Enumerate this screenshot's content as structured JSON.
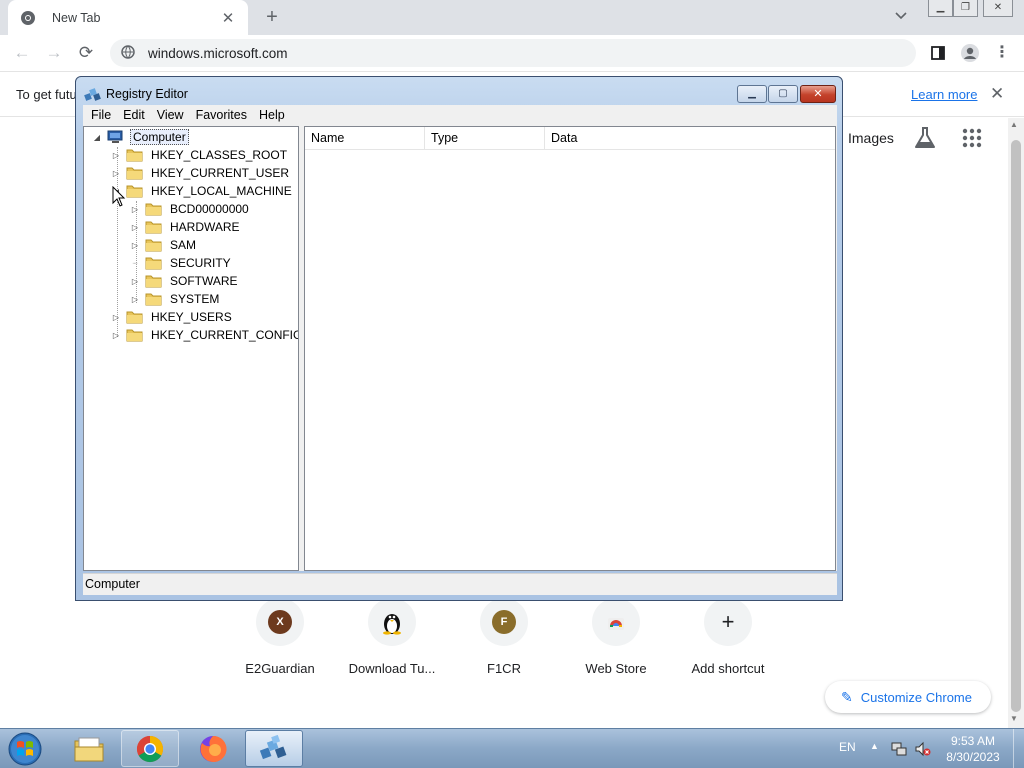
{
  "browser": {
    "tab_title": "New Tab",
    "url": "windows.microsoft.com",
    "infobar_text": "To get futu",
    "infobar_link": "Learn more"
  },
  "ntp": {
    "images_link": "Images",
    "shortcuts": [
      {
        "label": "E2Guardian",
        "letter": "X",
        "color": "#6d3a1e"
      },
      {
        "label": "Download Tu...",
        "letter": "",
        "color": ""
      },
      {
        "label": "F1CR",
        "letter": "F",
        "color": "#8a6d2b"
      },
      {
        "label": "Web Store",
        "letter": "",
        "color": ""
      },
      {
        "label": "Add shortcut",
        "letter": "+",
        "color": ""
      }
    ],
    "customize_label": "Customize Chrome"
  },
  "regedit": {
    "title": "Registry Editor",
    "menu": [
      "File",
      "Edit",
      "View",
      "Favorites",
      "Help"
    ],
    "tree": {
      "root": "Computer",
      "hives": [
        "HKEY_CLASSES_ROOT",
        "HKEY_CURRENT_USER",
        "HKEY_LOCAL_MACHINE",
        "HKEY_USERS",
        "HKEY_CURRENT_CONFIG"
      ],
      "hklm_children": [
        "BCD00000000",
        "HARDWARE",
        "SAM",
        "SECURITY",
        "SOFTWARE",
        "SYSTEM"
      ]
    },
    "columns": [
      "Name",
      "Type",
      "Data"
    ],
    "status": "Computer"
  },
  "taskbar": {
    "language": "EN",
    "time": "9:53 AM",
    "date": "8/30/2023"
  }
}
